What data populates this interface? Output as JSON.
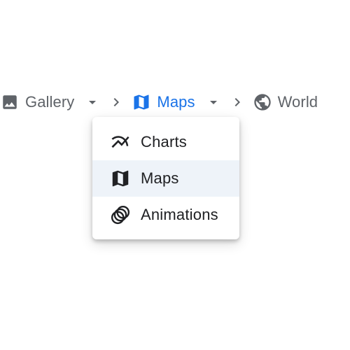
{
  "breadcrumb": {
    "items": [
      {
        "label": "Gallery",
        "icon": "image-icon",
        "has_dropdown": true,
        "active": false
      },
      {
        "label": "Maps",
        "icon": "map-icon",
        "has_dropdown": true,
        "active": true
      },
      {
        "label": "World",
        "icon": "globe-icon",
        "has_dropdown": false,
        "active": false
      }
    ],
    "separator_icon": "chevron-right-icon"
  },
  "menu": {
    "items": [
      {
        "label": "Charts",
        "icon": "chart-line-icon",
        "selected": false
      },
      {
        "label": "Maps",
        "icon": "map-icon",
        "selected": true
      },
      {
        "label": "Animations",
        "icon": "animation-icon",
        "selected": false
      }
    ]
  },
  "colors": {
    "active": "#1a73e8",
    "text": "#5f6368",
    "menu_text": "#202124",
    "selected_bg": "#eef3f9"
  }
}
